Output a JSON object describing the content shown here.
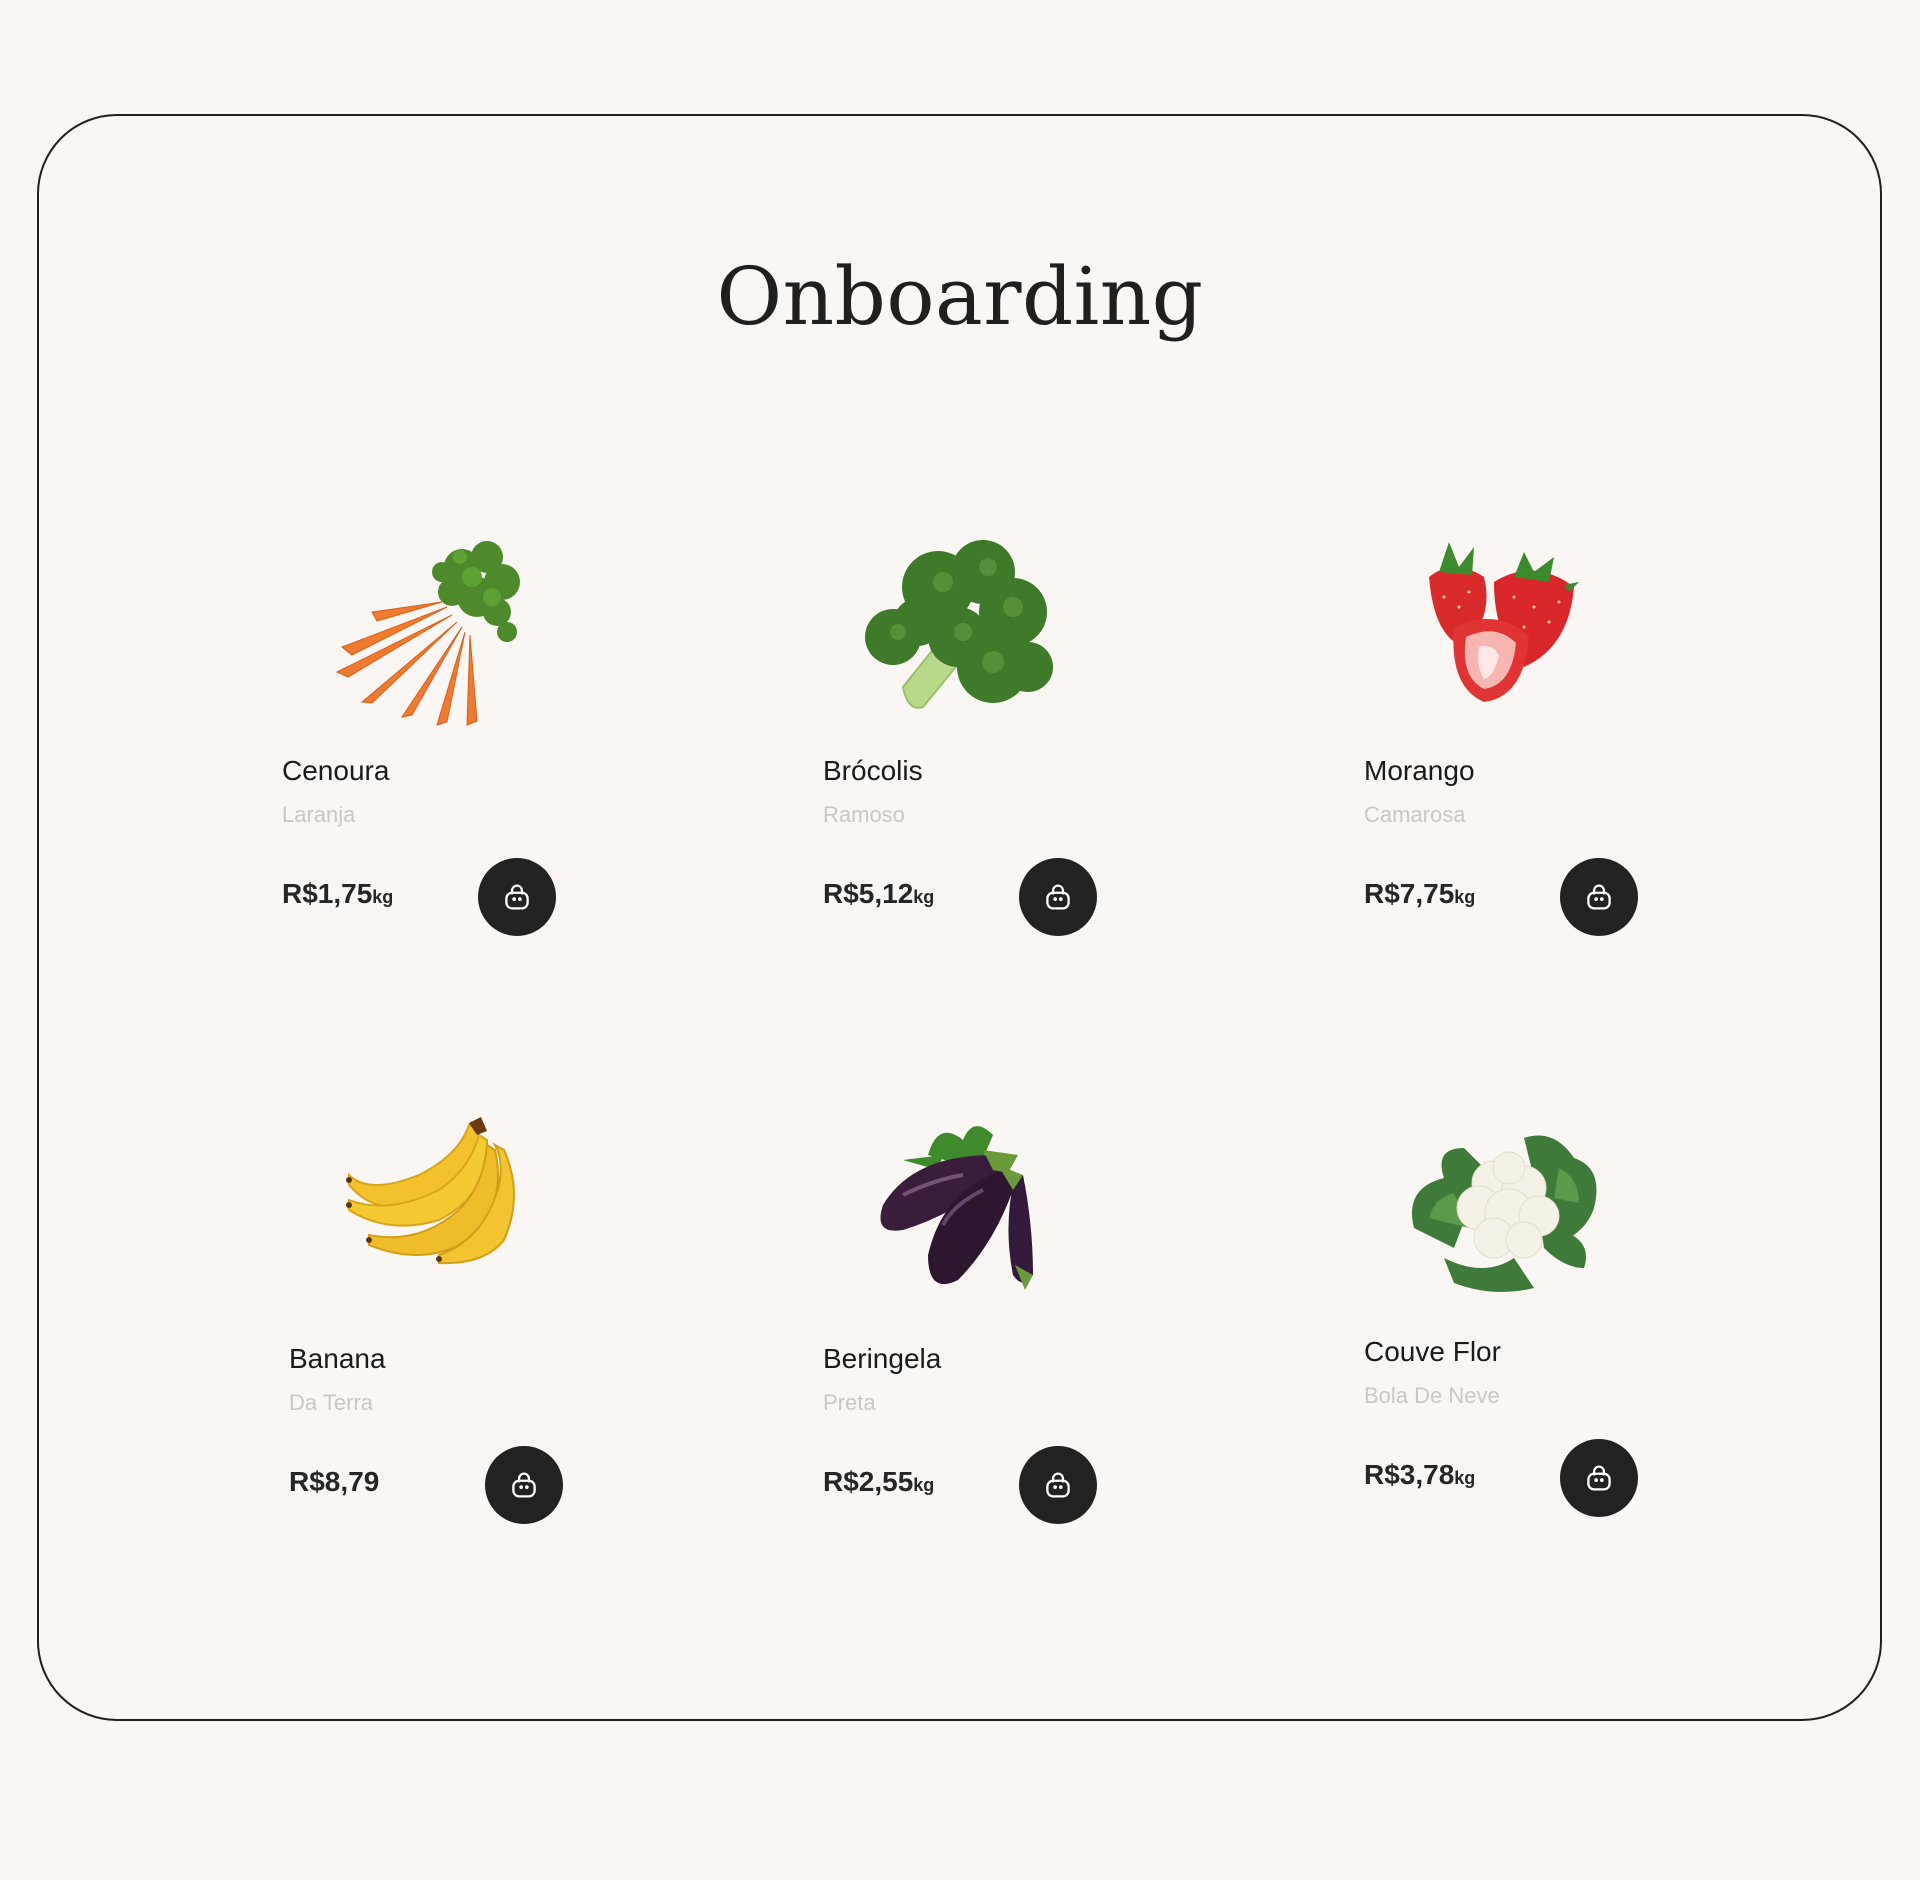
{
  "page": {
    "title": "Onboarding"
  },
  "products": [
    {
      "id": "cenoura",
      "name": "Cenoura",
      "variety": "Laranja",
      "price": "R$1,75",
      "unit": "kg",
      "image_icon": "carrot-icon"
    },
    {
      "id": "brocolis",
      "name": "Brócolis",
      "variety": "Ramoso",
      "price": "R$5,12",
      "unit": "kg",
      "image_icon": "broccoli-icon"
    },
    {
      "id": "morango",
      "name": "Morango",
      "variety": "Camarosa",
      "price": "R$7,75",
      "unit": "kg",
      "image_icon": "strawberry-icon"
    },
    {
      "id": "banana",
      "name": "Banana",
      "variety": "Da Terra",
      "price": "R$8,79",
      "unit": "",
      "image_icon": "banana-icon"
    },
    {
      "id": "beringela",
      "name": "Beringela",
      "variety": "Preta",
      "price": "R$2,55",
      "unit": "kg",
      "image_icon": "eggplant-icon"
    },
    {
      "id": "couveflor",
      "name": "Couve Flor",
      "variety": "Bola De Neve",
      "price": "R$3,78",
      "unit": "kg",
      "image_icon": "cauliflower-icon"
    }
  ],
  "cart_button": {
    "icon": "shopping-bag-icon"
  },
  "colors": {
    "background": "#f9f6f3",
    "frame_border": "#1f1f1f",
    "button_bg": "#222222",
    "muted_text": "#c9c6c3"
  }
}
